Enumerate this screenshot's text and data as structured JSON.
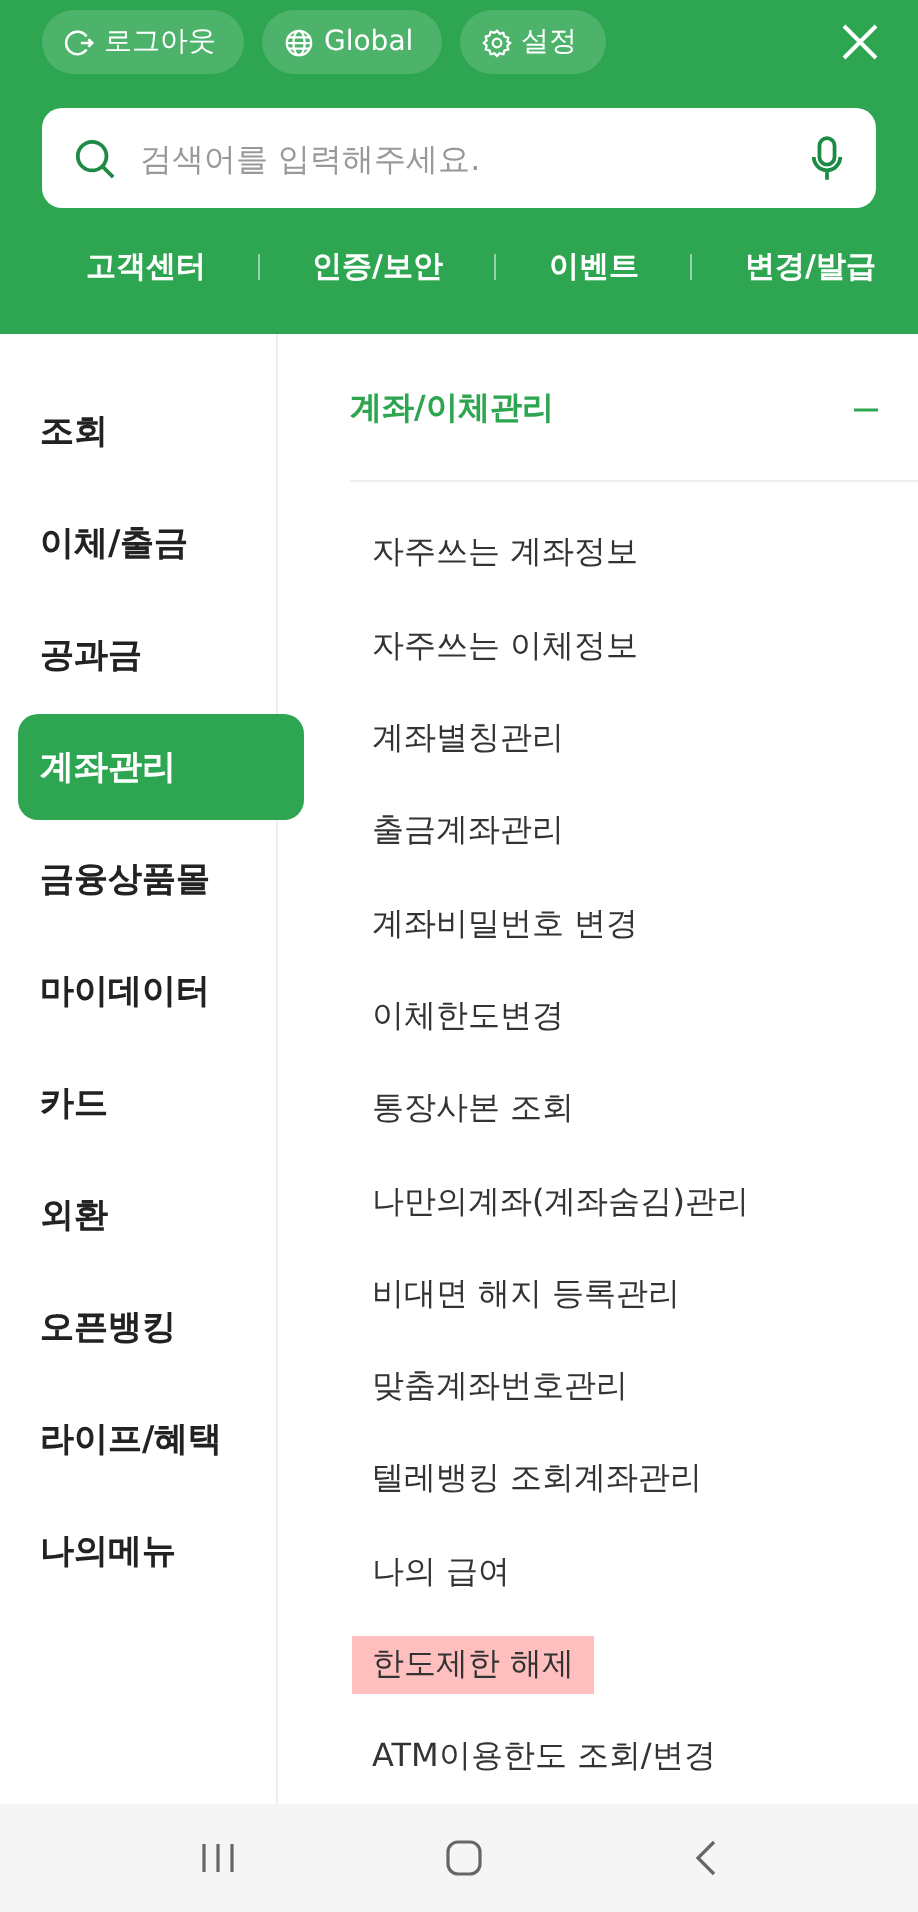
{
  "header": {
    "chips": [
      {
        "kind": "logout",
        "label": "로그아웃"
      },
      {
        "kind": "global",
        "label": "Global"
      },
      {
        "kind": "settings",
        "label": "설정"
      }
    ],
    "search": {
      "placeholder": "검색어를 입력해주세요."
    },
    "links": [
      "고객센터",
      "인증/보안",
      "이벤트",
      "변경/발급"
    ]
  },
  "sidebar": {
    "items": [
      {
        "label": "조회",
        "selected": false
      },
      {
        "label": "이체/출금",
        "selected": false
      },
      {
        "label": "공과금",
        "selected": false
      },
      {
        "label": "계좌관리",
        "selected": true
      },
      {
        "label": "금융상품몰",
        "selected": false
      },
      {
        "label": "마이데이터",
        "selected": false
      },
      {
        "label": "카드",
        "selected": false
      },
      {
        "label": "외환",
        "selected": false
      },
      {
        "label": "오픈뱅킹",
        "selected": false
      },
      {
        "label": "라이프/혜택",
        "selected": false
      },
      {
        "label": "나의메뉴",
        "selected": false
      }
    ]
  },
  "submenu": {
    "title": "계좌/이체관리",
    "expanded": true,
    "items": [
      {
        "label": "자주쓰는 계좌정보",
        "highlighted": false
      },
      {
        "label": "자주쓰는 이체정보",
        "highlighted": false
      },
      {
        "label": "계좌별칭관리",
        "highlighted": false
      },
      {
        "label": "출금계좌관리",
        "highlighted": false
      },
      {
        "label": "계좌비밀번호 변경",
        "highlighted": false
      },
      {
        "label": "이체한도변경",
        "highlighted": false
      },
      {
        "label": "통장사본 조회",
        "highlighted": false
      },
      {
        "label": "나만의계좌(계좌숨김)관리",
        "highlighted": false
      },
      {
        "label": "비대면 해지 등록관리",
        "highlighted": false
      },
      {
        "label": "맞춤계좌번호관리",
        "highlighted": false
      },
      {
        "label": "텔레뱅킹 조회계좌관리",
        "highlighted": false
      },
      {
        "label": "나의 급여",
        "highlighted": false
      },
      {
        "label": "한도제한 해제",
        "highlighted": true
      },
      {
        "label": "ATM이용한도 조회/변경",
        "highlighted": false
      }
    ]
  }
}
